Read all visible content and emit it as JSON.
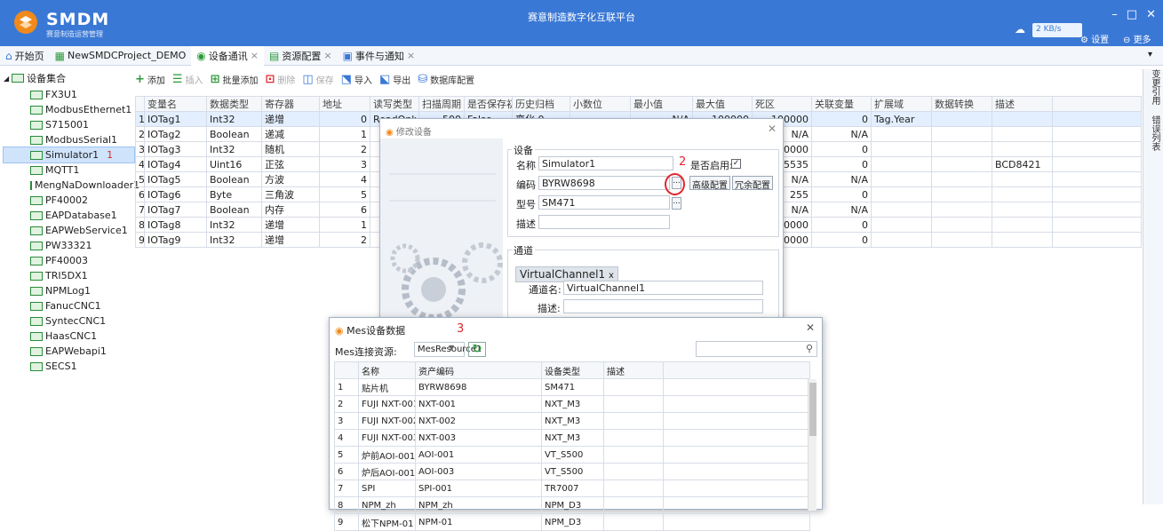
{
  "titlebar": {
    "brand": "SMDM",
    "brand_sub": "赛意制造运营管理",
    "app_title": "赛意制造数字化互联平台",
    "net_speed": "2 KB/s",
    "settings": "设置",
    "more": "更多",
    "accent": "#3a78d6"
  },
  "tabs": [
    {
      "label": "开始页",
      "closable": false
    },
    {
      "label": "NewSMDCProject_DEMO",
      "closable": false
    },
    {
      "label": "设备通讯",
      "closable": true
    },
    {
      "label": "资源配置",
      "closable": true
    },
    {
      "label": "事件与通知",
      "closable": true
    }
  ],
  "right_strip": {
    "item1": "变更引用",
    "item2": "错误列表"
  },
  "tree": {
    "root": "设备集合",
    "items": [
      "FX3U1",
      "ModbusEthernet1",
      "S715001",
      "ModbusSerial1",
      "Simulator1",
      "MQTT1",
      "MengNaDownloader1",
      "PF40002",
      "EAPDatabase1",
      "EAPWebService1",
      "PW33321",
      "PF40003",
      "TRI5DX1",
      "NPMLog1",
      "FanucCNC1",
      "SyntecCNC1",
      "HaasCNC1",
      "EAPWebapi1",
      "SECS1"
    ],
    "selected_index": 4,
    "marker": "1"
  },
  "toolbar": {
    "add": "添加",
    "insert": "插入",
    "batch_add": "批量添加",
    "delete": "删除",
    "save": "保存",
    "import": "导入",
    "export": "导出",
    "db_config": "数据库配置"
  },
  "grid": {
    "headers": [
      "",
      "变量名",
      "数据类型",
      "寄存器",
      "地址",
      "读写类型",
      "扫描周期",
      "是否保存初值",
      "历史归档",
      "小数位",
      "最小值",
      "最大值",
      "死区",
      "关联变量",
      "扩展域",
      "数据转换",
      "描述"
    ],
    "rows": [
      [
        "1",
        "IOTag1",
        "Int32",
        "递增",
        "0",
        "ReadOnly",
        "500",
        "False",
        "变化 0",
        "",
        "N/A",
        "-100000",
        "100000",
        "0",
        "Tag.Year",
        "",
        "",
        ""
      ],
      [
        "2",
        "IOTag2",
        "Boolean",
        "递减",
        "1",
        "",
        "",
        "",
        "",
        "",
        "",
        "",
        "N/A",
        "N/A",
        "",
        "",
        "",
        ""
      ],
      [
        "3",
        "IOTag3",
        "Int32",
        "随机",
        "2",
        "",
        "",
        "",
        "",
        "",
        "",
        "",
        "100000",
        "0",
        "",
        "",
        "",
        ""
      ],
      [
        "4",
        "IOTag4",
        "Uint16",
        "正弦",
        "3",
        "",
        "",
        "",
        "",
        "",
        "",
        "",
        "65535",
        "0",
        "",
        "",
        "BCD8421",
        ""
      ],
      [
        "5",
        "IOTag5",
        "Boolean",
        "方波",
        "4",
        "",
        "",
        "",
        "",
        "",
        "",
        "",
        "N/A",
        "N/A",
        "",
        "",
        "",
        ""
      ],
      [
        "6",
        "IOTag6",
        "Byte",
        "三角波",
        "5",
        "",
        "",
        "",
        "",
        "",
        "",
        "",
        "255",
        "0",
        "",
        "",
        "",
        ""
      ],
      [
        "7",
        "IOTag7",
        "Boolean",
        "内存",
        "6",
        "",
        "",
        "",
        "",
        "",
        "",
        "",
        "N/A",
        "N/A",
        "",
        "",
        "",
        ""
      ],
      [
        "8",
        "IOTag8",
        "Int32",
        "递增",
        "1",
        "",
        "",
        "",
        "",
        "",
        "",
        "",
        "100000",
        "0",
        "",
        "",
        "",
        ""
      ],
      [
        "9",
        "IOTag9",
        "Int32",
        "递增",
        "2",
        "",
        "",
        "",
        "",
        "",
        "",
        "",
        "100000",
        "0",
        "",
        "",
        "",
        ""
      ]
    ]
  },
  "edit_dialog": {
    "title": "修改设备",
    "device_group": "设备",
    "name_label": "名称",
    "name_value": "Simulator1",
    "enabled_label": "是否启用:",
    "code_label": "编码",
    "code_value": "BYRW8698",
    "advanced": "高级配置",
    "redundant": "冗余配置",
    "model_label": "型号",
    "model_value": "SM471",
    "desc_label": "描述",
    "channel_group": "通道",
    "channel_chip": "VirtualChannel1",
    "channel_name_label": "通道名:",
    "channel_name_value": "VirtualChannel1",
    "channel_desc_label": "描述:",
    "marker": "2"
  },
  "mes_dialog": {
    "title": "Mes设备数据",
    "resource_label": "Mes连接资源:",
    "resource_value": "MesResource1",
    "marker": "3",
    "headers": [
      "",
      "名称",
      "资产编码",
      "设备类型",
      "描述"
    ],
    "rows": [
      [
        "1",
        "贴片机",
        "BYRW8698",
        "SM471",
        ""
      ],
      [
        "2",
        "FUJI NXT-001",
        "NXT-001",
        "NXT_M3",
        ""
      ],
      [
        "3",
        "FUJI NXT-002",
        "NXT-002",
        "NXT_M3",
        ""
      ],
      [
        "4",
        "FUJI NXT-003",
        "NXT-003",
        "NXT_M3",
        ""
      ],
      [
        "5",
        "炉前AOI-001",
        "AOI-001",
        "VT_S500",
        ""
      ],
      [
        "6",
        "炉后AOI-001",
        "AOI-003",
        "VT_S500",
        ""
      ],
      [
        "7",
        "SPI",
        "SPI-001",
        "TR7007",
        ""
      ],
      [
        "8",
        "NPM_zh",
        "NPM_zh",
        "NPM_D3",
        ""
      ],
      [
        "9",
        "松下NPM-01",
        "NPM-01",
        "NPM_D3",
        ""
      ]
    ]
  }
}
